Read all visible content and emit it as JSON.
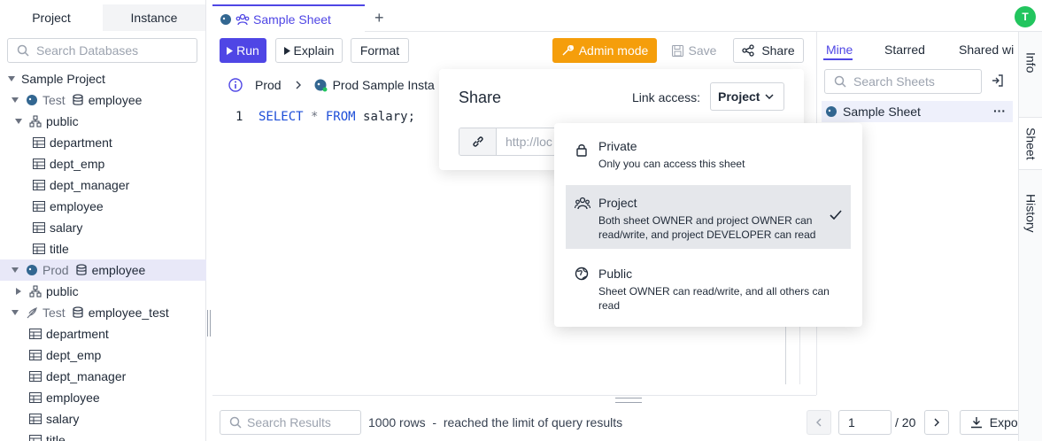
{
  "left_panel": {
    "tabs": [
      "Project",
      "Instance"
    ],
    "search_placeholder": "Search Databases",
    "tree": {
      "root": "Sample Project",
      "test_env": "Test",
      "test_db": "employee",
      "test_schema": "public",
      "test_tables": [
        "department",
        "dept_emp",
        "dept_manager",
        "employee",
        "salary",
        "title"
      ],
      "prod_env": "Prod",
      "prod_db": "employee",
      "prod_schema": "public",
      "test2_env": "Test",
      "test2_db": "employee_test",
      "test2_tables": [
        "department",
        "dept_emp",
        "dept_manager",
        "employee",
        "salary",
        "title"
      ]
    }
  },
  "top_tabs": {
    "active_tab": "Sample Sheet",
    "add_label": "+",
    "avatar_initial": "T"
  },
  "toolbar": {
    "run": "Run",
    "explain": "Explain",
    "format": "Format",
    "admin_mode": "Admin mode",
    "save": "Save",
    "share": "Share"
  },
  "breadcrumb": {
    "environment": "Prod",
    "instance": "Prod Sample Insta"
  },
  "editor": {
    "line_number": "1",
    "sql_keyword1": "SELECT",
    "sql_star": " * ",
    "sql_keyword2": "FROM",
    "sql_rest": " salary;"
  },
  "share_popover": {
    "title": "Share",
    "link_access_label": "Link access:",
    "selected_access": "Project",
    "link_placeholder": "http://loc"
  },
  "access_menu": {
    "options": [
      {
        "label": "Private",
        "description": "Only you can access this sheet"
      },
      {
        "label": "Project",
        "description": "Both sheet OWNER and project OWNER can read/write, and project DEVELOPER can read",
        "selected": true
      },
      {
        "label": "Public",
        "description": "Sheet OWNER can read/write, and all others can read"
      }
    ]
  },
  "right_panel": {
    "tabs": [
      "Mine",
      "Starred",
      "Shared wi"
    ],
    "search_placeholder": "Search Sheets",
    "sheet_item": "Sample Sheet",
    "more": "···"
  },
  "side_tabs": [
    "Info",
    "Sheet",
    "History"
  ],
  "results": {
    "search_placeholder": "Search Results",
    "rows_info": "1000 rows  -  reached the limit of query results",
    "page_value": "1",
    "page_total": "/ 20",
    "export": "Export"
  },
  "colors": {
    "accent": "#4f46e5",
    "admin": "#f59e0b",
    "avatar": "#22c55e"
  }
}
